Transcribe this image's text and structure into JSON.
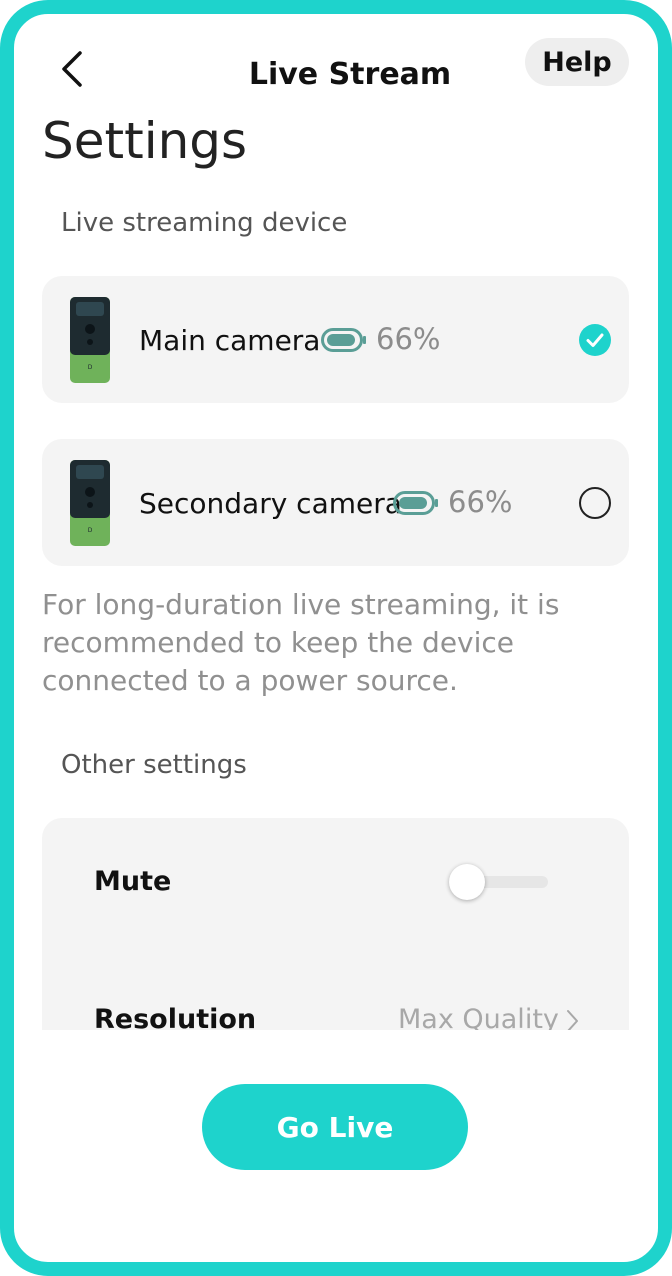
{
  "header": {
    "back_icon": "chevron-left-icon",
    "title": "Live Stream",
    "help_label": "Help"
  },
  "page_title": "Settings",
  "devices_section": {
    "label": "Live streaming device",
    "devices": [
      {
        "name": "Main camera",
        "battery": "66%",
        "battery_icon": "battery-icon",
        "selected": true
      },
      {
        "name": "Secondary camera",
        "battery": "66%",
        "battery_icon": "battery-icon",
        "selected": false
      }
    ],
    "note": "For long-duration live streaming, it is recommended to keep the device connected to a power source."
  },
  "other_settings": {
    "label": "Other settings",
    "mute_label": "Mute",
    "mute_on": false,
    "resolution_label": "Resolution",
    "resolution_value": "Max Quality"
  },
  "go_live_label": "Go Live",
  "colors": {
    "accent": "#1ed3cc",
    "card_bg": "#f4f4f4",
    "battery": "#5a9e96"
  }
}
